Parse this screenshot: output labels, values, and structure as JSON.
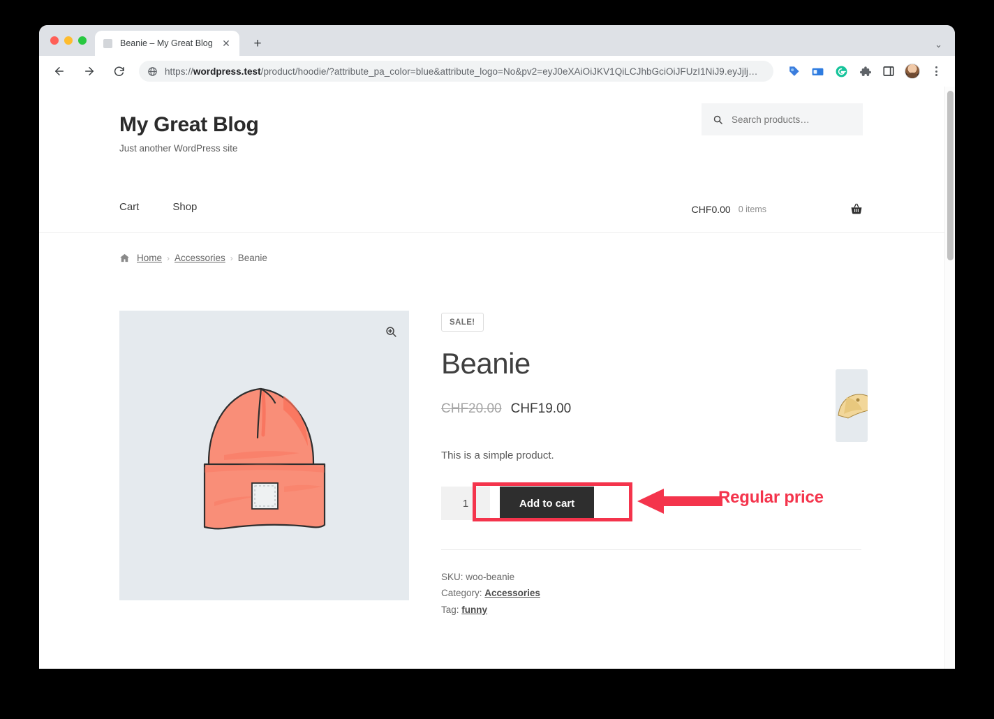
{
  "browser": {
    "tab": {
      "title": "Beanie – My Great Blog",
      "close_label": "✕",
      "favicon_name": "page-favicon"
    },
    "new_tab_label": "+",
    "tab_list_caret": "⌄",
    "omnibox": {
      "url_prefix": "https://",
      "url_domain": "wordpress.test",
      "url_rest": "/product/hoodie/?attribute_pa_color=blue&attribute_logo=No&pv2=eyJ0eXAiOiJKV1QiLCJhbGciOiJFUzI1NiJ9.eyJjlj…",
      "full_url": "https://wordpress.test/product/hoodie/?attribute_pa_color=blue&attribute_logo=No&pv2=eyJ0eXAiOiJKV1QiLCJhbGciOiJFUzI1NiJ9.eyJjlj…"
    },
    "toolbar_icons": [
      "back-icon",
      "forward-icon",
      "reload-icon",
      "site-info-globe-icon",
      "tag-extension-icon",
      "card-extension-icon",
      "grammarly-extension-icon",
      "extensions-puzzle-icon",
      "side-panel-icon",
      "profile-avatar",
      "chrome-menu-kebab-icon"
    ]
  },
  "site": {
    "title": "My Great Blog",
    "description": "Just another WordPress site",
    "search": {
      "placeholder": "Search products…",
      "value": ""
    },
    "nav": [
      {
        "label": "Cart"
      },
      {
        "label": "Shop"
      }
    ],
    "cart": {
      "amount": "CHF0.00",
      "count": "0 items",
      "icon": "shopping-basket-icon"
    }
  },
  "breadcrumb": {
    "home": "Home",
    "sep": "›",
    "category": "Accessories",
    "current": "Beanie"
  },
  "product": {
    "badge": "SALE!",
    "title": "Beanie",
    "price_old": "CHF20.00",
    "price_new": "CHF19.00",
    "short_description": "This is a simple product.",
    "quantity": "1",
    "add_to_cart_label": "Add to cart",
    "zoom_icon": "magnifier-zoom-icon",
    "meta": {
      "sku_label": "SKU:",
      "sku_value": "woo-beanie",
      "category_label": "Category:",
      "category_value": "Accessories",
      "tag_label": "Tag:",
      "tag_value": "funny"
    }
  },
  "annotation": {
    "label": "Regular price",
    "color": "#f4344c"
  },
  "colors": {
    "accent_red": "#f4344c",
    "button_dark": "#2e2e2e",
    "image_bg": "#e5eaee",
    "product_pink": "#f98e78"
  }
}
